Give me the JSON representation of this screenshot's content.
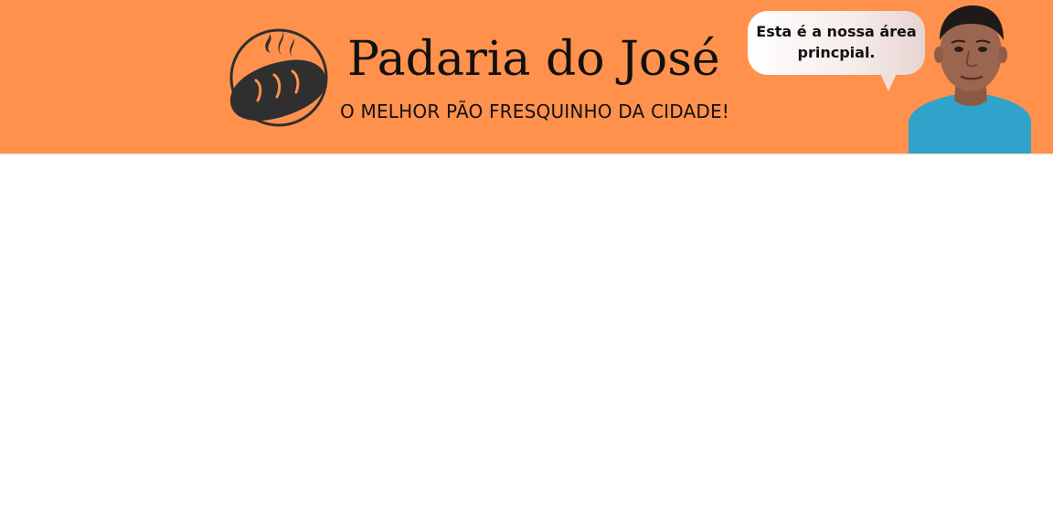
{
  "header": {
    "title": "Padaria do José",
    "tagline": "O MELHOR PÃO FRESQUINHO DA CIDADE!",
    "logo_icon": "bread-steam-logo-icon",
    "background_color": "#FF914D"
  },
  "speech_bubble": {
    "text": "Esta é a nossa área\nprincpial."
  },
  "avatar": {
    "icon": "person-avatar-photo",
    "shirt_color": "#2FA3C9"
  }
}
